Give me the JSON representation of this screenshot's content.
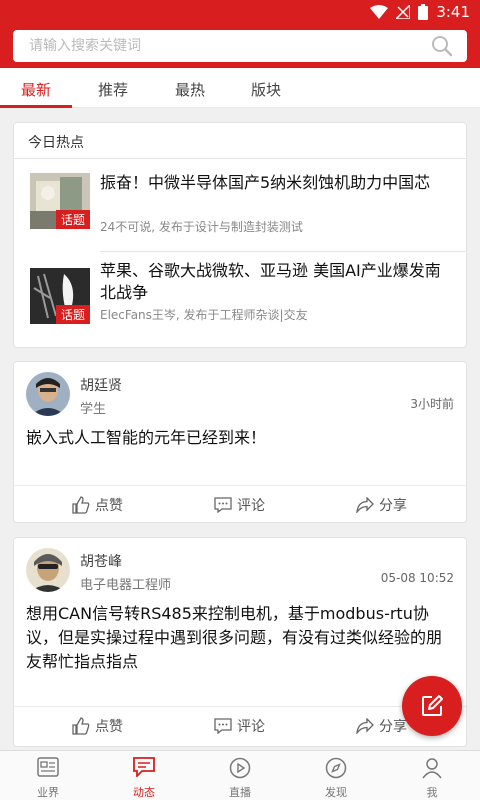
{
  "status_bar": {
    "time": "3:41"
  },
  "search": {
    "placeholder": "请输入搜索关键词"
  },
  "tabs": [
    {
      "label": "最新",
      "active": true
    },
    {
      "label": "推荐"
    },
    {
      "label": "最热"
    },
    {
      "label": "版块"
    }
  ],
  "hot": {
    "title": "今日热点",
    "items": [
      {
        "headline": "振奋！中微半导体国产5纳米刻蚀机助力中国芯",
        "meta": "24不可说, 发布于设计与制造封装测试",
        "badge": "话题"
      },
      {
        "headline": "苹果、谷歌大战微软、亚马逊 美国AI产业爆发南北战争",
        "meta": "ElecFans王岑, 发布于工程师杂谈|交友",
        "badge": "话题"
      }
    ]
  },
  "posts": [
    {
      "author": "胡廷贤",
      "role": "学生",
      "time": "3小时前",
      "text": "嵌入式人工智能的元年已经到来！"
    },
    {
      "author": "胡苍峰",
      "role": "电子电器工程师",
      "time": "05-08 10:52",
      "text": "想用CAN信号转RS485来控制电机，基于modbus-rtu协议，但是实操过程中遇到很多问题，有没有过类似经验的朋友帮忙指点指点"
    }
  ],
  "actions": {
    "like": "点赞",
    "comment": "评论",
    "share": "分享"
  },
  "nav": [
    {
      "label": "业界",
      "icon": "news-icon"
    },
    {
      "label": "动态",
      "icon": "chat-icon",
      "active": true
    },
    {
      "label": "直播",
      "icon": "play-icon"
    },
    {
      "label": "发现",
      "icon": "compass-icon"
    },
    {
      "label": "我",
      "icon": "person-icon"
    }
  ],
  "colors": {
    "brand": "#d81e1e"
  }
}
